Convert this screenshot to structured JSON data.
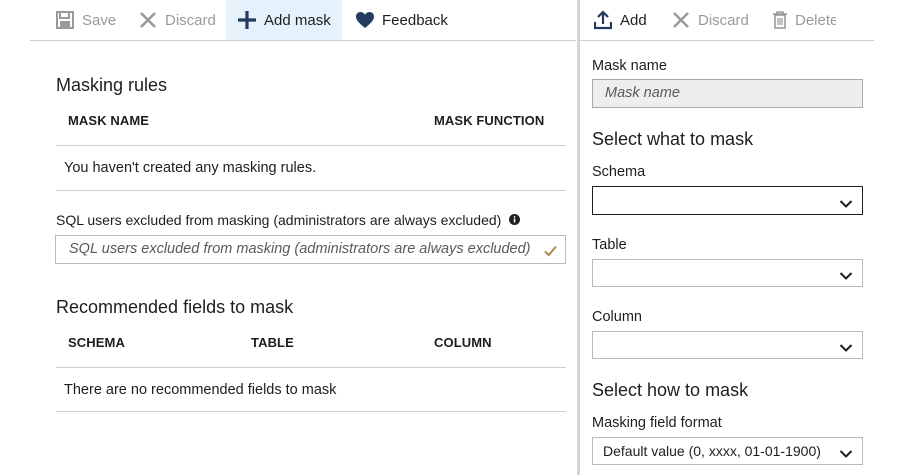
{
  "toolbar": {
    "save_label": "Save",
    "discard_label": "Discard",
    "add_mask_label": "Add mask",
    "feedback_label": "Feedback"
  },
  "masking_rules": {
    "title": "Masking rules",
    "columns": [
      "MASK NAME",
      "MASK FUNCTION"
    ],
    "empty_message": "You haven't created any masking rules."
  },
  "excluded_users": {
    "label": "SQL users excluded from masking (administrators are always excluded)",
    "placeholder": "SQL users excluded from masking (administrators are always excluded)"
  },
  "recommended": {
    "title": "Recommended fields to mask",
    "columns": [
      "SCHEMA",
      "TABLE",
      "COLUMN"
    ],
    "empty_message": "There are no recommended fields to mask"
  },
  "right_toolbar": {
    "add_label": "Add",
    "discard_label": "Discard",
    "delete_label": "Delete"
  },
  "mask_form": {
    "mask_name_label": "Mask name",
    "mask_name_placeholder": "Mask name",
    "select_what_title": "Select what to mask",
    "schema_label": "Schema",
    "schema_value": "",
    "table_label": "Table",
    "table_value": "",
    "column_label": "Column",
    "column_value": "",
    "select_how_title": "Select how to mask",
    "format_label": "Masking field format",
    "format_value": "Default value (0, xxxx, 01-01-1900)"
  },
  "colors": {
    "accent": "#0072c6",
    "icon_dark": "#243a5e",
    "disabled": "#9a9a9a",
    "checkmark": "#a98b4f",
    "active_tab_bg": "#e6f2fb"
  }
}
